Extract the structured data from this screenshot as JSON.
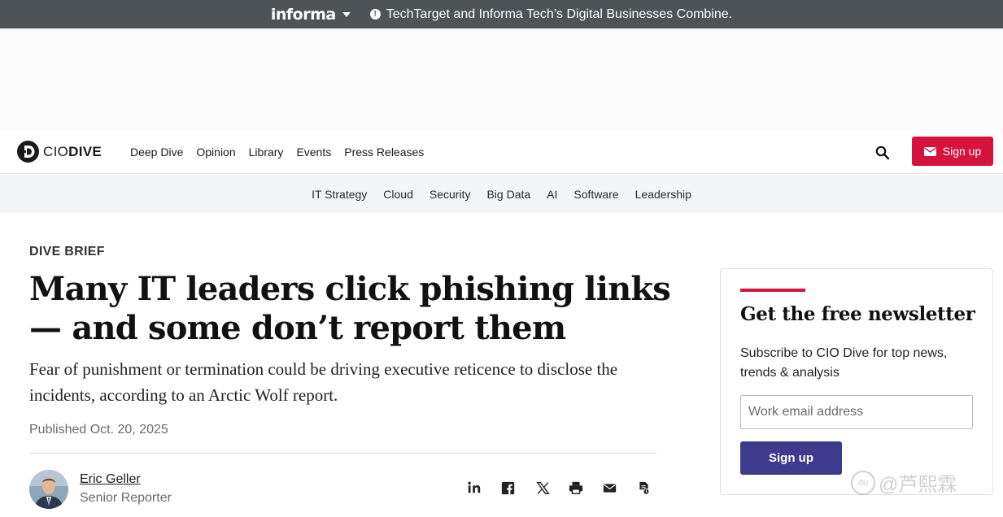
{
  "informa_bar": {
    "logo": "informa",
    "announcement": "TechTarget and Informa Tech’s Digital Businesses Combine."
  },
  "site": {
    "brand_light": "CIO",
    "brand_bold": "DIVE"
  },
  "nav": {
    "items": [
      "Deep Dive",
      "Opinion",
      "Library",
      "Events",
      "Press Releases"
    ],
    "signup_label": "Sign up"
  },
  "topics": [
    "IT Strategy",
    "Cloud",
    "Security",
    "Big Data",
    "AI",
    "Software",
    "Leadership"
  ],
  "article": {
    "kicker": "DIVE BRIEF",
    "headline": "Many IT leaders click phishing links — and some don’t report them",
    "dek": "Fear of punishment or termination could be driving executive reticence to disclose the incidents, according to an Arctic Wolf report.",
    "published": "Published Oct. 20, 2025",
    "author_name": "Eric Geller",
    "author_title": "Senior Reporter"
  },
  "share_icons": [
    "linkedin-icon",
    "facebook-icon",
    "x-icon",
    "print-icon",
    "email-icon",
    "license-icon"
  ],
  "newsletter": {
    "title": "Get the free newsletter",
    "description": "Subscribe to CIO Dive for top news, trends & analysis",
    "email_placeholder": "Work email address",
    "button_label": "Sign up"
  },
  "watermark": {
    "text": "@芦熙霖",
    "icon_text": "du"
  },
  "colors": {
    "accent_red": "#d6133c",
    "newsletter_button": "#3e3a8c",
    "informa_bar": "#4d5357"
  }
}
